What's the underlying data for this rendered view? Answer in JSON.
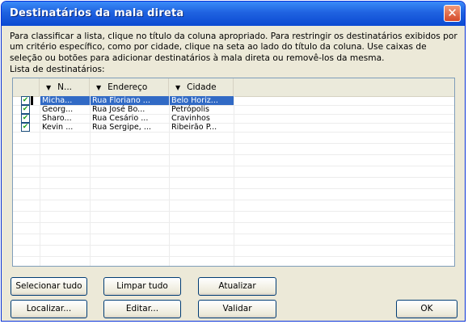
{
  "dialog": {
    "title": "Destinatários da mala direta",
    "close_glyph": "✕"
  },
  "instructions": "Para classificar a lista, clique no título da coluna apropriado. Para restringir os destinatários exibidos por um critério específico, como por cidade, clique na seta ao lado do título da coluna. Use caixas de seleção ou botões para adicionar destinatários à mala direta ou removê-los da mesma.",
  "list_label": "Lista de destinatários:",
  "columns": [
    {
      "label": "N...",
      "arrow": "▼"
    },
    {
      "label": "Endereço",
      "arrow": "▼"
    },
    {
      "label": "Cidade",
      "arrow": "▼"
    }
  ],
  "rows": [
    {
      "checked": true,
      "selected": true,
      "nome": "Micha...",
      "endereco": "Rua Floriano ...",
      "cidade": "Belo Horiz..."
    },
    {
      "checked": true,
      "selected": false,
      "nome": "Georg...",
      "endereco": "Rua José Bo...",
      "cidade": "Petrópolis"
    },
    {
      "checked": true,
      "selected": false,
      "nome": "Sharo...",
      "endereco": "Rua Cesário ...",
      "cidade": "Cravinhos"
    },
    {
      "checked": true,
      "selected": false,
      "nome": "Kevin ...",
      "endereco": "Rua Sergipe, ...",
      "cidade": "Ribeirão P..."
    }
  ],
  "buttons": {
    "select_all": "Selecionar tudo",
    "clear_all": "Limpar tudo",
    "refresh": "Atualizar",
    "find": "Localizar...",
    "edit": "Editar...",
    "validate": "Validar",
    "ok": "OK"
  },
  "colors": {
    "titlebar": "#0b4ad2",
    "selection": "#316ac5",
    "check": "#21a121"
  }
}
